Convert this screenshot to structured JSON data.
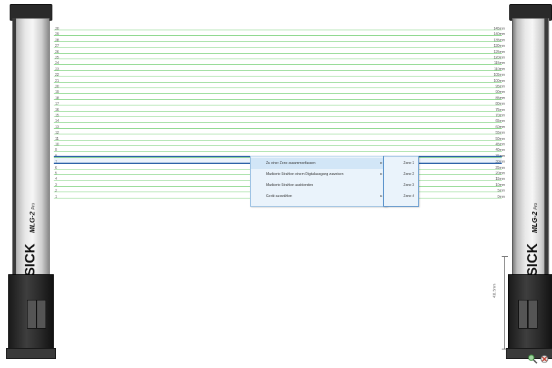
{
  "device": {
    "brand": "SICK",
    "model": "MLG-2",
    "model_suffix": "Pro"
  },
  "beams": [
    {
      "num": "30",
      "mm": "145mm"
    },
    {
      "num": "29",
      "mm": "140mm"
    },
    {
      "num": "28",
      "mm": "135mm"
    },
    {
      "num": "27",
      "mm": "130mm"
    },
    {
      "num": "26",
      "mm": "125mm"
    },
    {
      "num": "25",
      "mm": "120mm"
    },
    {
      "num": "24",
      "mm": "115mm"
    },
    {
      "num": "23",
      "mm": "110mm"
    },
    {
      "num": "22",
      "mm": "105mm"
    },
    {
      "num": "21",
      "mm": "100mm"
    },
    {
      "num": "20",
      "mm": "95mm"
    },
    {
      "num": "19",
      "mm": "90mm"
    },
    {
      "num": "18",
      "mm": "85mm"
    },
    {
      "num": "17",
      "mm": "80mm"
    },
    {
      "num": "16",
      "mm": "75mm"
    },
    {
      "num": "15",
      "mm": "70mm"
    },
    {
      "num": "14",
      "mm": "65mm"
    },
    {
      "num": "13",
      "mm": "60mm"
    },
    {
      "num": "12",
      "mm": "55mm"
    },
    {
      "num": "11",
      "mm": "50mm"
    },
    {
      "num": "10",
      "mm": "45mm"
    },
    {
      "num": "9",
      "mm": "40mm"
    },
    {
      "num": "8",
      "mm": "35mm"
    },
    {
      "num": "7",
      "mm": "30mm"
    },
    {
      "num": "6",
      "mm": "25mm"
    },
    {
      "num": "5",
      "mm": "20mm"
    },
    {
      "num": "4",
      "mm": "15mm"
    },
    {
      "num": "3",
      "mm": "10mm"
    },
    {
      "num": "2",
      "mm": "5mm"
    },
    {
      "num": "1",
      "mm": "0mm"
    }
  ],
  "selected_beam": "14",
  "context_menu": {
    "items": [
      {
        "label": "Zu einer Zone zusammenfassen",
        "has_submenu": true
      },
      {
        "label": "Markierte Strahlen einem Digitalausgang zuweisen",
        "has_submenu": true
      },
      {
        "label": "Markierte Strahlen ausblenden",
        "has_submenu": false
      },
      {
        "label": "Gerät auswählen",
        "has_submenu": true
      }
    ],
    "submenu": [
      "Zone 1",
      "Zone 2",
      "Zone 3",
      "Zone 4"
    ]
  },
  "height_label": "411.5mm",
  "icons": {
    "zoom": "zoom-icon",
    "config": "config-icon"
  },
  "colors": {
    "beam": "#8fd88f",
    "selection": "#2d62a8",
    "menu_bg": "#eaf3fb"
  }
}
